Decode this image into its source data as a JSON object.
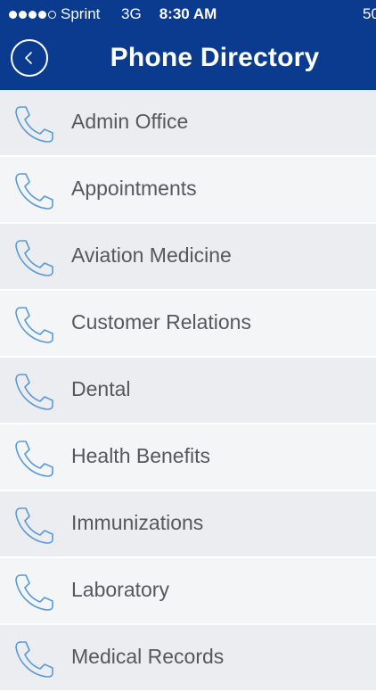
{
  "status_bar": {
    "carrier": "Sprint",
    "network": "3G",
    "time": "8:30 AM",
    "battery": "50"
  },
  "header": {
    "title": "Phone Directory",
    "back_icon": "chevron-left-icon"
  },
  "colors": {
    "header_bg": "#0b3b8f",
    "row_shade_a": "#ebedf0",
    "row_shade_b": "#f4f5f7",
    "icon_stroke": "#5b9bd5",
    "label_text": "#55585d"
  },
  "directory": {
    "icon": "phone-icon",
    "items": [
      {
        "label": "Admin Office"
      },
      {
        "label": "Appointments"
      },
      {
        "label": "Aviation Medicine"
      },
      {
        "label": "Customer Relations"
      },
      {
        "label": "Dental"
      },
      {
        "label": "Health Benefits"
      },
      {
        "label": "Immunizations"
      },
      {
        "label": "Laboratory"
      },
      {
        "label": "Medical Records"
      }
    ]
  }
}
